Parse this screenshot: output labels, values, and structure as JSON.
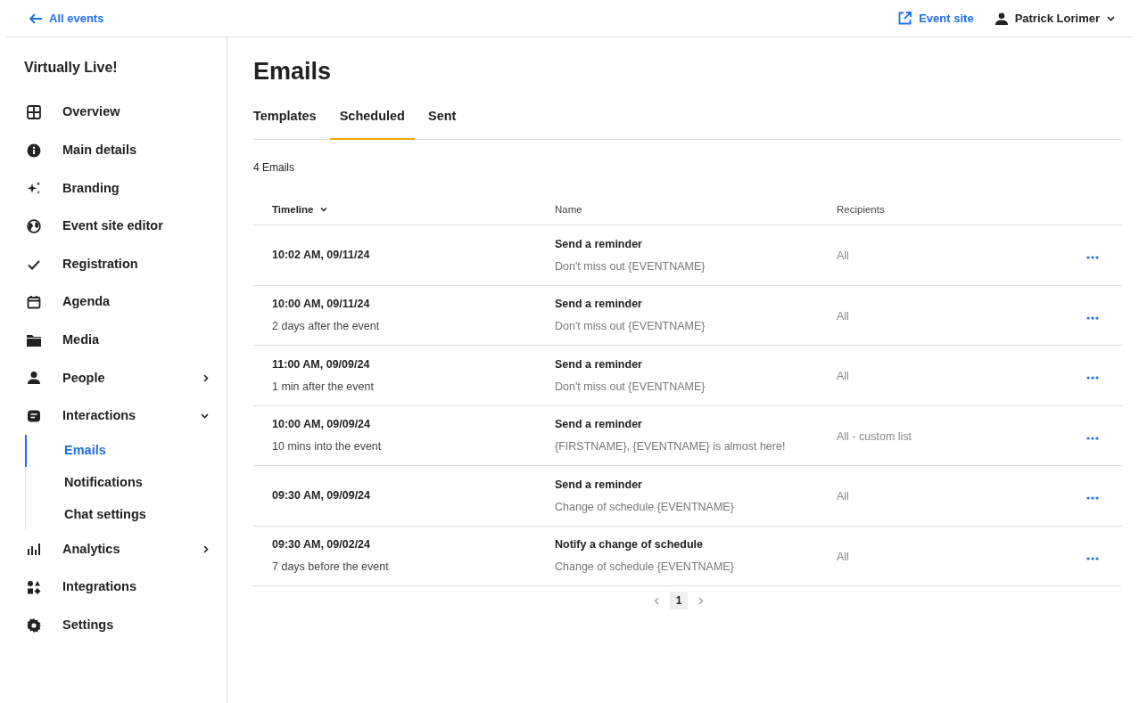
{
  "topbar": {
    "back_link": "All events",
    "event_site_link": "Event site",
    "user_menu": "Patrick Lorimer"
  },
  "sidebar": {
    "title": "Virtually Live!",
    "items": [
      {
        "label": "Overview",
        "selected": false
      },
      {
        "label": "Main details",
        "selected": false
      },
      {
        "label": "Branding",
        "selected": false
      },
      {
        "label": "Event site editor",
        "selected": false
      },
      {
        "label": "Registration",
        "selected": false
      },
      {
        "label": "Agenda",
        "selected": false
      },
      {
        "label": "Media",
        "selected": false
      },
      {
        "label": "People",
        "selected": false,
        "expanded": false
      },
      {
        "label": "Interactions",
        "selected": false,
        "expanded": true,
        "children": [
          {
            "label": "Emails",
            "selected": true
          },
          {
            "label": "Notifications",
            "selected": false
          },
          {
            "label": "Chat settings",
            "selected": false
          }
        ]
      },
      {
        "label": "Analytics",
        "selected": false,
        "expanded": false
      },
      {
        "label": "Integrations",
        "selected": false
      },
      {
        "label": "Settings",
        "selected": false
      }
    ]
  },
  "page": {
    "title": "Emails",
    "tabs": [
      {
        "label": "Templates",
        "selected": false
      },
      {
        "label": "Scheduled",
        "selected": true
      },
      {
        "label": "Sent",
        "selected": false
      }
    ],
    "count": "4 Emails"
  },
  "table": {
    "columns": [
      "Timeline",
      "Name",
      "Recipients"
    ],
    "rows": [
      {
        "time": "10:02 AM, 09/11/24",
        "name": "Send a reminder",
        "subject": "Don't miss out {EVENTNAME}",
        "recipients": "All"
      },
      {
        "time": "10:00 AM, 09/11/24",
        "timing": "2 days after the event",
        "name": "Send a reminder",
        "subject": "Don't miss out {EVENTNAME}",
        "recipients": "All"
      },
      {
        "time": "11:00 AM, 09/09/24",
        "timing": "1 min after the event",
        "name": "Send a reminder",
        "subject": "Don't miss out {EVENTNAME}",
        "recipients": "All"
      },
      {
        "time": "10:00 AM, 09/09/24",
        "timing": "10 mins into the event",
        "name": "Send a reminder",
        "subject": "{FIRSTNAME}, {EVENTNAME} is almost here!",
        "recipients": "All - custom list"
      },
      {
        "time": "09:30 AM, 09/09/24",
        "name": "Send a reminder",
        "subject": "Change of schedule {EVENTNAME}",
        "recipients": "All"
      },
      {
        "time": "09:30 AM, 09/02/24",
        "timing": "7 days before the event",
        "name": "Notify a change of schedule",
        "subject": "Change of schedule {EVENTNAME}",
        "recipients": "All"
      }
    ]
  },
  "pagination": {
    "pages": [
      {
        "label": "1",
        "selected": true
      }
    ]
  }
}
